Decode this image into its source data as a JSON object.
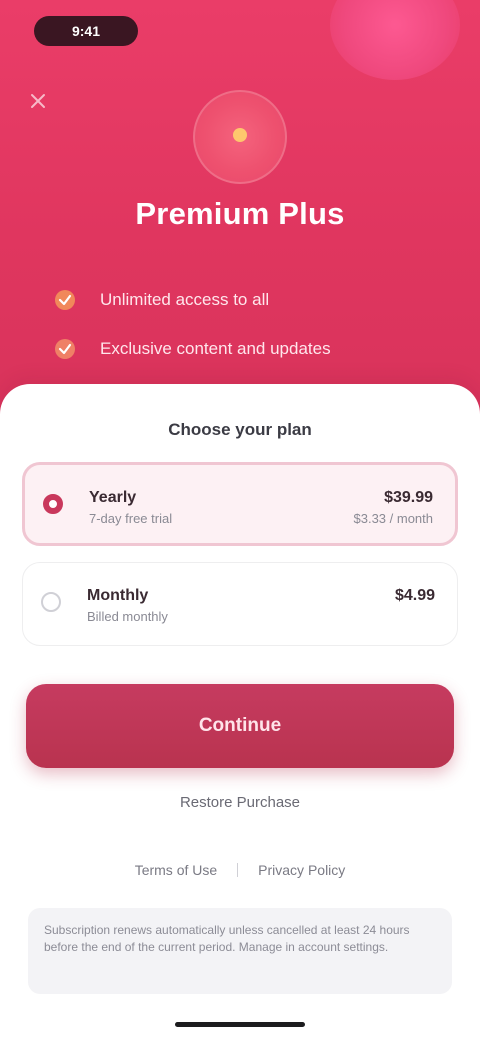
{
  "status_bar": {
    "time": "9:41"
  },
  "header": {
    "close_icon": "close-icon",
    "logo_icon": "star-icon",
    "title": "Premium Plus",
    "features": [
      {
        "icon": "check-icon",
        "text": "Unlimited access to all"
      },
      {
        "icon": "check-icon",
        "text": "Exclusive content and updates"
      }
    ]
  },
  "plans": {
    "heading": "Choose your plan",
    "options": [
      {
        "name": "Yearly",
        "subtitle": "7-day free trial",
        "price": "$39.99",
        "price_sub": "$3.33 / month",
        "selected": true
      },
      {
        "name": "Monthly",
        "subtitle": "Billed monthly",
        "price": "$4.99",
        "price_sub": "",
        "selected": false
      }
    ]
  },
  "cta": {
    "label": "Continue"
  },
  "restore": {
    "label": "Restore Purchase"
  },
  "legal": {
    "terms": "Terms of Use",
    "privacy": "Privacy Policy"
  },
  "disclaimer": {
    "text": "Subscription renews automatically unless cancelled at least 24 hours before the end of the current period. Manage in account settings."
  },
  "colors": {
    "hero": "#e43a63",
    "accent": "#c9385c",
    "cta": "#c0375a",
    "selected_card_bg": "#fdf1f4"
  }
}
